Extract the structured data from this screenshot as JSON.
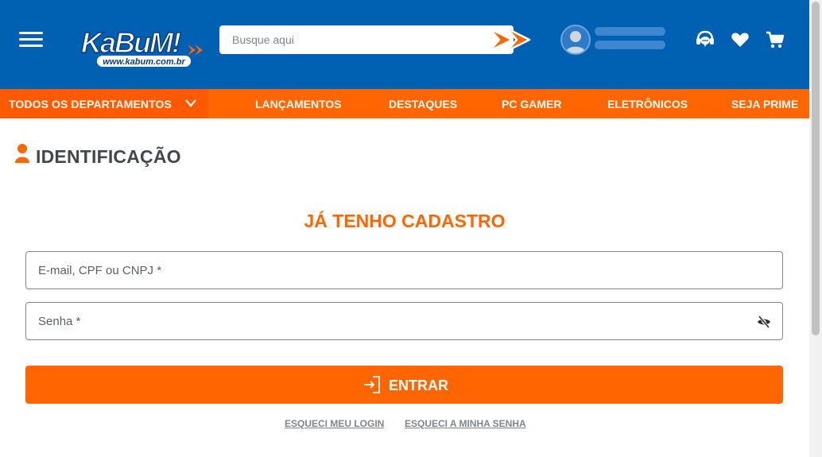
{
  "header": {
    "search_placeholder": "Busque aqui",
    "icons": [
      "menu-icon",
      "search-go-icon",
      "user-icon",
      "support-icon",
      "heart-icon",
      "cart-icon"
    ],
    "logo_text": "KaBuM!",
    "logo_url_text": "www.kabum.com.br"
  },
  "nav": {
    "departments_label": "TODOS OS DEPARTAMENTOS",
    "items": [
      "LANÇAMENTOS",
      "DESTAQUES",
      "PC GAMER",
      "ELETRÔNICOS",
      "SEJA PRIME"
    ]
  },
  "main": {
    "page_title": "IDENTIFICAÇÃO",
    "section_title": "JÁ TENHO CADASTRO",
    "login_placeholder": "E-mail, CPF ou CNPJ *",
    "password_placeholder": "Senha *",
    "enter_label": "ENTRAR",
    "forgot_login": "ESQUECI MEU LOGIN",
    "forgot_password": "ESQUECI A MINHA SENHA"
  },
  "colors": {
    "header_blue": "#0060b1",
    "brand_orange": "#ff6500",
    "text_dark": "#42464d",
    "link_gray": "#7f858d"
  }
}
